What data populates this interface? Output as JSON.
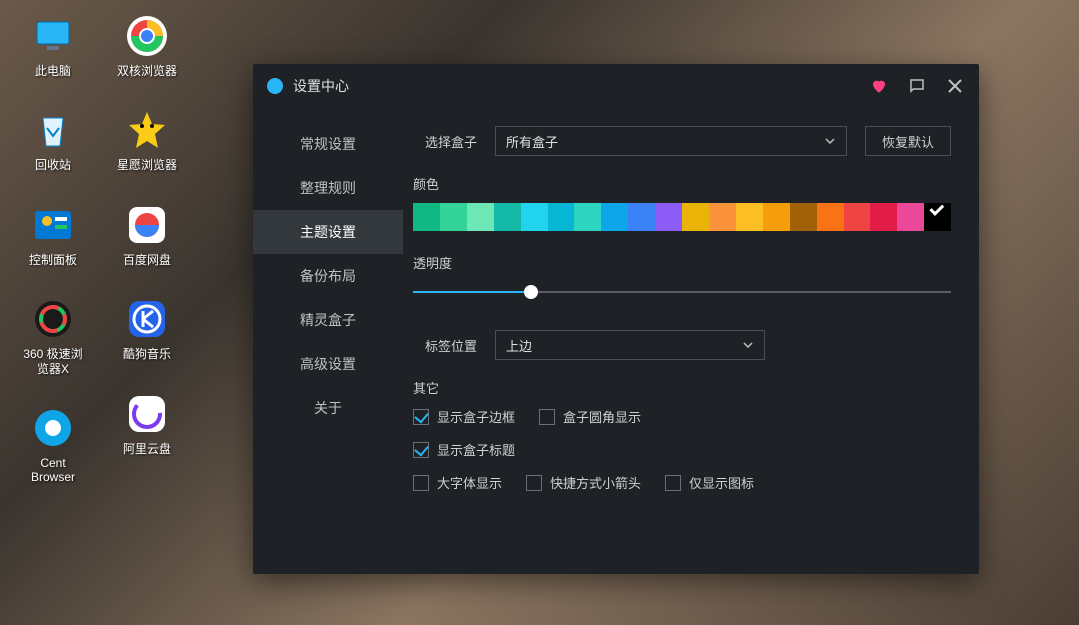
{
  "desktop": {
    "col1": [
      {
        "name": "pc-icon",
        "label": "此电脑",
        "bg": "#0078d4",
        "glyph": "pc"
      },
      {
        "name": "recycle-icon",
        "label": "回收站",
        "bg": "#ffffff",
        "glyph": "recycle"
      },
      {
        "name": "control-panel-icon",
        "label": "控制面板",
        "bg": "#0078d4",
        "glyph": "cpl"
      },
      {
        "name": "360-browser-icon",
        "label": "360 极速浏览器X",
        "bg": "#1a1a1a",
        "glyph": "360"
      },
      {
        "name": "cent-browser-icon",
        "label": "Cent Browser",
        "bg": "#0ea5e9",
        "glyph": "cent"
      }
    ],
    "col2": [
      {
        "name": "dual-browser-icon",
        "label": "双核浏览器",
        "bg": "#ffffff",
        "glyph": "chrome"
      },
      {
        "name": "star-browser-icon",
        "label": "星愿浏览器",
        "bg": "#facc15",
        "glyph": "star"
      },
      {
        "name": "baidu-disk-icon",
        "label": "百度网盘",
        "bg": "#ffffff",
        "glyph": "baidu"
      },
      {
        "name": "kugou-icon",
        "label": "酷狗音乐",
        "bg": "#2563eb",
        "glyph": "kugou"
      },
      {
        "name": "aliyun-disk-icon",
        "label": "阿里云盘",
        "bg": "#ffffff",
        "glyph": "aliyun"
      }
    ]
  },
  "window": {
    "title": "设置中心",
    "sidebar": [
      {
        "label": "常规设置",
        "active": false
      },
      {
        "label": "整理规则",
        "active": false
      },
      {
        "label": "主题设置",
        "active": true
      },
      {
        "label": "备份布局",
        "active": false
      },
      {
        "label": "精灵盒子",
        "active": false
      },
      {
        "label": "高级设置",
        "active": false
      },
      {
        "label": "关于",
        "active": false
      }
    ],
    "content": {
      "select_box_label": "选择盒子",
      "select_box_value": "所有盒子",
      "restore_default": "恢复默认",
      "color_label": "颜色",
      "colors": [
        "#10b981",
        "#34d399",
        "#6ee7b7",
        "#14b8a6",
        "#22d3ee",
        "#06b6d4",
        "#2dd4bf",
        "#0ea5e9",
        "#3b82f6",
        "#8b5cf6",
        "#eab308",
        "#fb923c",
        "#fbbf24",
        "#f59e0b",
        "#a16207",
        "#f97316",
        "#ef4444",
        "#e11d48",
        "#ec4899",
        "#000000"
      ],
      "color_selected_index": 19,
      "opacity_label": "透明度",
      "opacity_percent": 22,
      "label_pos_label": "标签位置",
      "label_pos_value": "上边",
      "other_label": "其它",
      "checkboxes": [
        [
          {
            "label": "显示盒子边框",
            "checked": true
          },
          {
            "label": "盒子圆角显示",
            "checked": false
          }
        ],
        [
          {
            "label": "显示盒子标题",
            "checked": true
          }
        ],
        [
          {
            "label": "大字体显示",
            "checked": false
          },
          {
            "label": "快捷方式小箭头",
            "checked": false
          },
          {
            "label": "仅显示图标",
            "checked": false
          }
        ]
      ]
    }
  }
}
